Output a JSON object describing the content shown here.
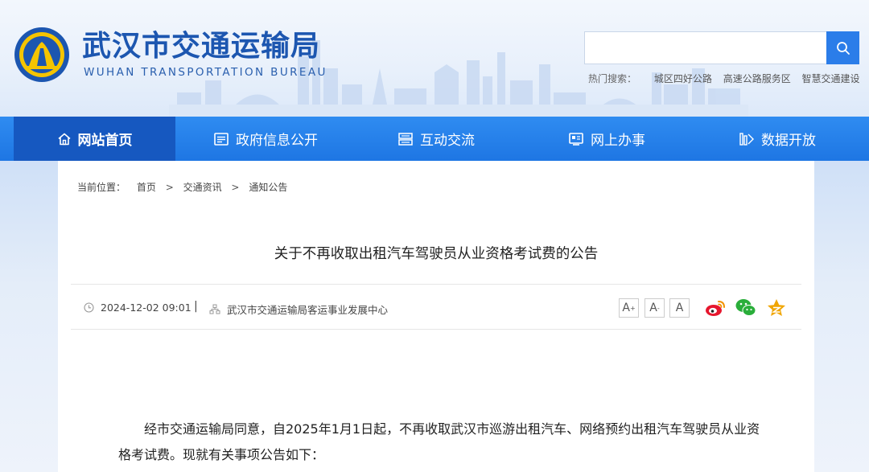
{
  "header": {
    "title": "武汉市交通运输局",
    "subtitle": "WUHAN TRANSPORTATION BUREAU",
    "search": {
      "placeholder": "",
      "value": ""
    },
    "hot_label": "热门搜索：",
    "hot_keywords": [
      "城区四好公路",
      "高速公路服务区",
      "智慧交通建设"
    ]
  },
  "nav": {
    "items": [
      {
        "label": "网站首页",
        "icon": "home-icon",
        "active": true
      },
      {
        "label": "政府信息公开",
        "icon": "document-icon",
        "active": false
      },
      {
        "label": "互动交流",
        "icon": "interaction-icon",
        "active": false
      },
      {
        "label": "网上办事",
        "icon": "service-icon",
        "active": false
      },
      {
        "label": "数据开放",
        "icon": "data-icon",
        "active": false
      }
    ]
  },
  "breadcrumb": {
    "label": "当前位置：",
    "items": [
      "首页",
      "交通资讯",
      "通知公告"
    ],
    "separator": ">"
  },
  "article": {
    "title": "关于不再收取出租汽车驾驶员从业资格考试费的公告",
    "datetime": "2024-12-02 09:01",
    "divider": "|",
    "source": "武汉市交通运输局客运事业发展中心",
    "font_buttons": [
      "A+",
      "A-",
      "A"
    ],
    "share_icons": [
      "weibo-icon",
      "wechat-icon",
      "favorite-icon"
    ],
    "body": "经市交通运输局同意，自2025年1月1日起，不再收取武汉市巡游出租汽车、网络预约出租汽车驾驶员从业资格考试费。现就有关事项公告如下："
  },
  "colors": {
    "brand_blue": "#1c56b0",
    "nav_blue": "#1e76e3",
    "nav_active": "#1658c0",
    "logo_gold": "#f5c400"
  }
}
